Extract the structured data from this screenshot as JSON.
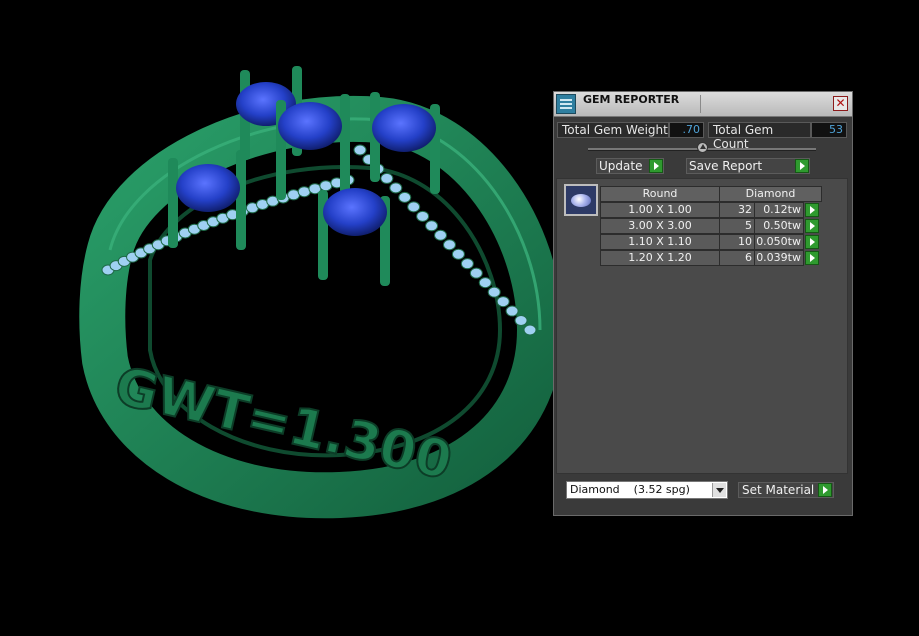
{
  "window": {
    "title": "GEM REPORTER",
    "close_label": "✕"
  },
  "summary": {
    "weight_label": "Total Gem Weight",
    "weight_value": ".70",
    "count_label": "Total Gem Count",
    "count_value": "53"
  },
  "buttons": {
    "update": "Update",
    "save_report": "Save Report",
    "set_material": "Set Material"
  },
  "table": {
    "columns": [
      "Round",
      "Diamond"
    ],
    "rows": [
      {
        "size": "1.00 X 1.00",
        "count": "32",
        "weight": "0.12tw"
      },
      {
        "size": "3.00 X 3.00",
        "count": "5",
        "weight": "0.50tw"
      },
      {
        "size": "1.10 X 1.10",
        "count": "10",
        "weight": "0.050tw"
      },
      {
        "size": "1.20 X 1.20",
        "count": "6",
        "weight": "0.039tw"
      }
    ]
  },
  "material": {
    "selected": "Diamond    (3.52 spg)"
  },
  "colors": {
    "ring_metal": "#1f8a5a",
    "sapphire": "#2440c8",
    "pave_diamond": "#9fd0f2",
    "value_text": "#4fa3d8"
  },
  "viewport": {
    "engraving": "GWT=1.300"
  }
}
